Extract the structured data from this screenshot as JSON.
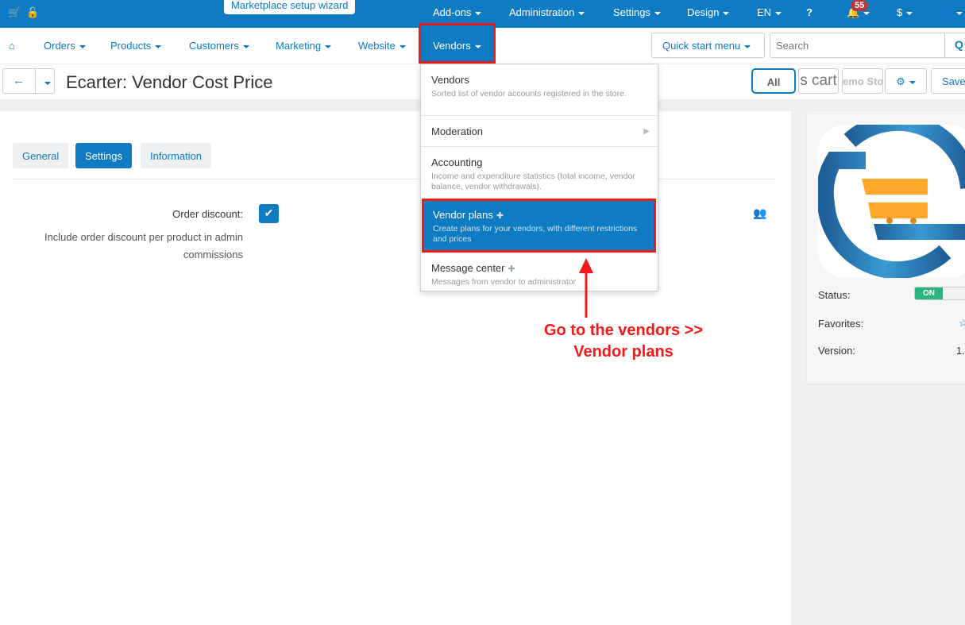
{
  "topbar": {
    "wizard": "Marketplace setup wizard",
    "menus": [
      "Add-ons",
      "Administration",
      "Settings",
      "Design",
      "EN"
    ],
    "notifications": "55",
    "currency": "$",
    "icons": [
      "cart-icon",
      "unlock-icon",
      "help-icon",
      "bell-icon",
      "user-icon"
    ]
  },
  "nav": {
    "items": [
      "Orders",
      "Products",
      "Customers",
      "Marketing",
      "Website"
    ],
    "vendors": "Vendors",
    "quick_start": "Quick start menu",
    "search_placeholder": "Search"
  },
  "header": {
    "title": "Ecarter: Vendor Cost Price",
    "all": "All",
    "store1": "s cart",
    "store2": "emo Sto",
    "save": "Save"
  },
  "tabs": [
    "General",
    "Settings",
    "Information"
  ],
  "form": {
    "label": "Order discount:",
    "checked": true,
    "help": "Include order discount per product in admin commissions"
  },
  "sidebar": {
    "status_label": "Status:",
    "status": "ON",
    "favorites_label": "Favorites:",
    "version_label": "Version:",
    "version": "1."
  },
  "dropdown": [
    {
      "title": "Vendors",
      "desc": "Sorted list of vendor accounts registered in the store."
    },
    {
      "title": "Moderation",
      "desc": ""
    },
    {
      "title": "Accounting",
      "desc": "Income and expenditure statistics (total income, vendor balance, vendor withdrawals)."
    },
    {
      "title": "Vendor plans",
      "desc": "Create plans for your vendors, with different restrictions and prices"
    },
    {
      "title": "Message center",
      "desc": "Messages from vendor to administrator"
    }
  ],
  "annotation": "Go to the vendors >> Vendor plans",
  "colors": {
    "primary": "#0e7bc2",
    "highlight": "#f31919",
    "on": "#2db37c"
  }
}
